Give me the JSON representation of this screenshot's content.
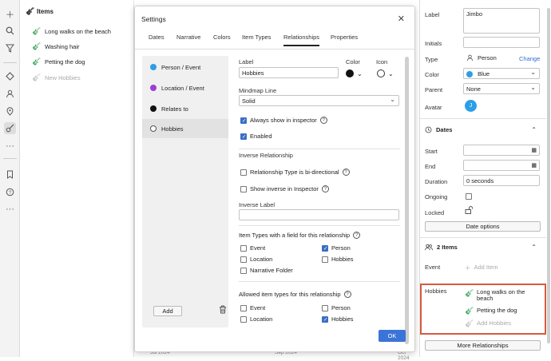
{
  "rail": {
    "icons": [
      "plus-icon",
      "search-icon",
      "filter-icon",
      "diamond-icon",
      "person-icon",
      "location-pin-icon",
      "guitar-icon",
      "more-icon",
      "bookmark-icon",
      "help-icon",
      "more-icon"
    ]
  },
  "left_panel": {
    "title": "Items",
    "items": [
      {
        "label": "Long walks on the beach"
      },
      {
        "label": "Washing hair"
      },
      {
        "label": "Petting the dog"
      }
    ],
    "new_item": "New Hobbies"
  },
  "dialog": {
    "title": "Settings",
    "tabs": [
      "Dates",
      "Narrative",
      "Colors",
      "Item Types",
      "Relationships",
      "Properties"
    ],
    "active_tab": "Relationships",
    "relationships": [
      {
        "label": "Person / Event",
        "color": "#2d9ee6"
      },
      {
        "label": "Location / Event",
        "color": "#9b3fd6"
      },
      {
        "label": "Relates to",
        "color": "#111111"
      },
      {
        "label": "Hobbies",
        "color": "#ffffff"
      }
    ],
    "add_label": "Add",
    "form": {
      "label_title": "Label",
      "label_value": "Hobbies",
      "color_title": "Color",
      "color_value": "#111111",
      "icon_title": "Icon",
      "mindmap_title": "Mindmap Line",
      "mindmap_value": "Solid",
      "always_show": "Always show in inspector",
      "enabled": "Enabled",
      "inverse_header": "Inverse Relationship",
      "bidirectional": "Relationship Type is bi-directional",
      "show_inverse": "Show inverse in Inspector",
      "inverse_label_title": "Inverse Label",
      "inverse_label_value": "",
      "field_types_title": "Item Types with a field for this relationship",
      "field_types": [
        {
          "label": "Event",
          "checked": false
        },
        {
          "label": "Person",
          "checked": true
        },
        {
          "label": "Location",
          "checked": false
        },
        {
          "label": "Hobbies",
          "checked": false
        },
        {
          "label": "Narrative Folder",
          "checked": false
        }
      ],
      "allowed_types_title": "Allowed item types for this relationship",
      "allowed_types": [
        {
          "label": "Event",
          "checked": false
        },
        {
          "label": "Person",
          "checked": false
        },
        {
          "label": "Location",
          "checked": false
        },
        {
          "label": "Hobbies",
          "checked": true
        }
      ]
    },
    "ok_label": "OK"
  },
  "timeline": {
    "ticks": [
      "Jul 2024",
      "Sep 2024",
      "Oct 2024"
    ]
  },
  "inspector": {
    "label_title": "Label",
    "label_value": "Jimbo",
    "initials_title": "Initials",
    "initials_value": "",
    "type_title": "Type",
    "type_value": "Person",
    "type_change": "Change",
    "color_title": "Color",
    "color_value": "Blue",
    "color_hex": "#2d9ee6",
    "parent_title": "Parent",
    "parent_value": "None",
    "avatar_title": "Avatar",
    "avatar_letter": "J",
    "dates_header": "Dates",
    "start_title": "Start",
    "end_title": "End",
    "duration_title": "Duration",
    "duration_value": "0 seconds",
    "ongoing_title": "Ongoing",
    "locked_title": "Locked",
    "date_options": "Date options",
    "items_header": "2 Items",
    "event_title": "Event",
    "add_item": "Add Item",
    "hobbies_title": "Hobbies",
    "hobbies": [
      {
        "label": "Long walks on the beach"
      },
      {
        "label": "Petting the dog"
      }
    ],
    "add_hobbies": "Add Hobbies",
    "more_relationships": "More Relationships"
  }
}
